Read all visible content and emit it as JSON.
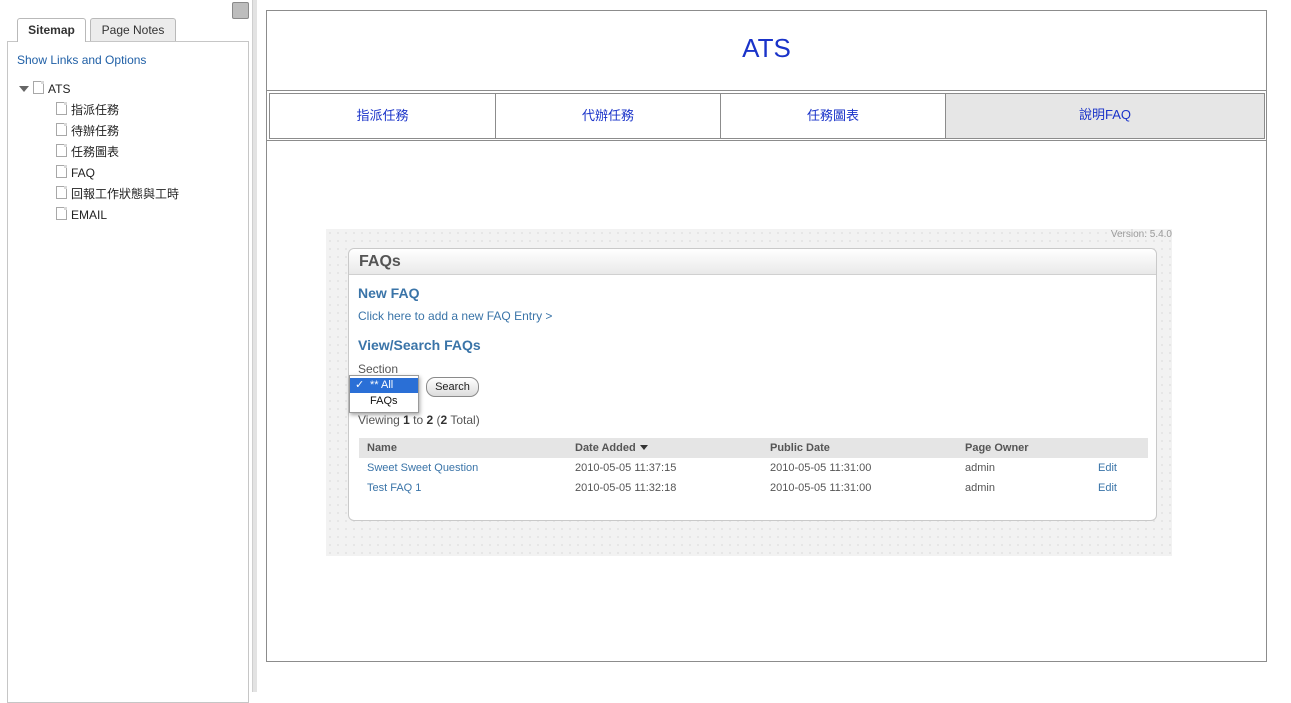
{
  "sidebar": {
    "tabs": [
      "Sitemap",
      "Page Notes"
    ],
    "show_links": "Show Links and Options",
    "tree_root": "ATS",
    "tree_items": [
      "指派任務",
      "待辦任務",
      "任務圖表",
      "FAQ",
      "回報工作狀態與工時",
      "EMAIL"
    ]
  },
  "header": {
    "title": "ATS"
  },
  "nav": [
    "指派任務",
    "代辦任務",
    "任務圖表",
    "說明FAQ"
  ],
  "app": {
    "version": "Version: 5.4.0",
    "box_title": "FAQs",
    "new_heading": "New FAQ",
    "new_link": "Click here to add a new FAQ Entry >",
    "view_heading": "View/Search FAQs",
    "section_label": "Section",
    "dropdown": {
      "options": [
        "** All",
        "FAQs"
      ],
      "selected": "** All",
      "check": "✓"
    },
    "search_button": "Search",
    "viewing": {
      "prefix": "Viewing ",
      "from": "1",
      "to_word": " to ",
      "to": "2",
      "open": " (",
      "total": "2",
      "close": " Total)"
    },
    "table": {
      "columns": [
        "Name",
        "Date Added",
        "Public Date",
        "Page Owner"
      ],
      "rows": [
        {
          "name": "Sweet Sweet Question",
          "date_added": "2010-05-05 11:37:15",
          "public_date": "2010-05-05 11:31:00",
          "owner": "admin",
          "action": "Edit"
        },
        {
          "name": "Test FAQ 1",
          "date_added": "2010-05-05 11:32:18",
          "public_date": "2010-05-05 11:31:00",
          "owner": "admin",
          "action": "Edit"
        }
      ]
    }
  }
}
